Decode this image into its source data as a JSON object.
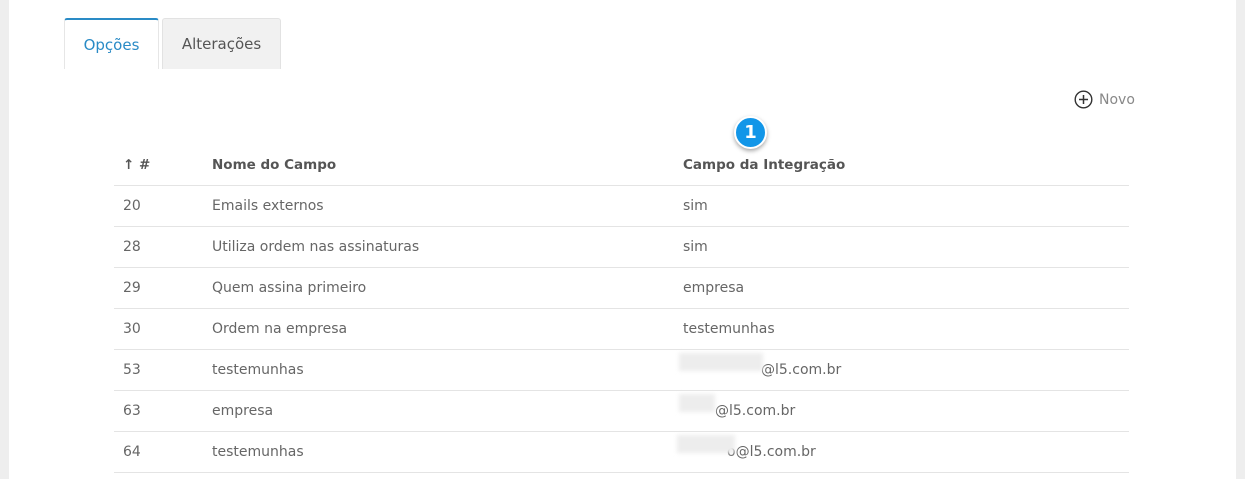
{
  "tabs": [
    {
      "label": "Opções",
      "active": true
    },
    {
      "label": "Alterações",
      "active": false
    }
  ],
  "toolbar": {
    "new_label": "Novo"
  },
  "badge": {
    "number": "1"
  },
  "table": {
    "headers": {
      "id": "↑ #",
      "name": "Nome do Campo",
      "integration": "Campo da Integração"
    },
    "rows": [
      {
        "id": "20",
        "name": "Emails externos",
        "integration": "sim"
      },
      {
        "id": "28",
        "name": "Utiliza ordem nas assinaturas",
        "integration": "sim"
      },
      {
        "id": "29",
        "name": "Quem assina primeiro",
        "integration": "empresa"
      },
      {
        "id": "30",
        "name": "Ordem na empresa",
        "integration": "testemunhas"
      },
      {
        "id": "53",
        "name": "testemunhas",
        "integration": "@l5.com.br"
      },
      {
        "id": "63",
        "name": "empresa",
        "integration": "@l5.com.br"
      },
      {
        "id": "64",
        "name": "testemunhas",
        "integration": "o@l5.com.br"
      }
    ]
  },
  "colors": {
    "accent": "#2a8bc6",
    "badge": "#1296e8"
  }
}
